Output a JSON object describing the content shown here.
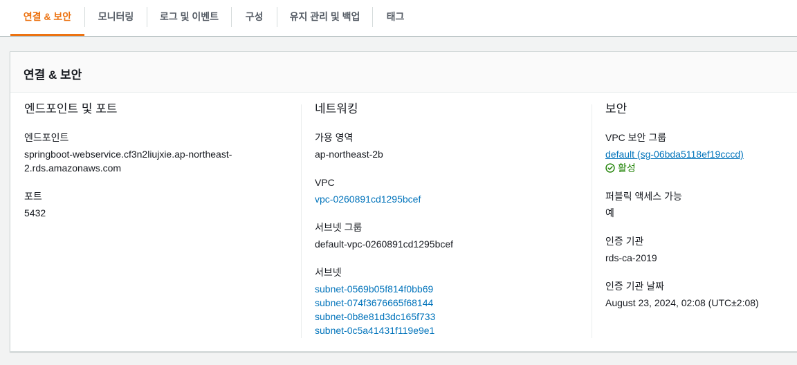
{
  "tabs": [
    {
      "label": "연결 & 보안",
      "active": true
    },
    {
      "label": "모니터링",
      "active": false
    },
    {
      "label": "로그 및 이벤트",
      "active": false
    },
    {
      "label": "구성",
      "active": false
    },
    {
      "label": "유지 관리 및 백업",
      "active": false
    },
    {
      "label": "태그",
      "active": false
    }
  ],
  "panel": {
    "title": "연결 & 보안",
    "endpoint_section": {
      "title": "엔드포인트 및 포트",
      "endpoint_label": "엔드포인트",
      "endpoint_value_line1": "springboot-webservice.cf3n2liujxie.ap-northeast-",
      "endpoint_value_line2": "2.rds.amazonaws.com",
      "port_label": "포트",
      "port_value": "5432"
    },
    "networking_section": {
      "title": "네트워킹",
      "az_label": "가용 영역",
      "az_value": "ap-northeast-2b",
      "vpc_label": "VPC",
      "vpc_value": "vpc-0260891cd1295bcef",
      "subnet_group_label": "서브넷 그룹",
      "subnet_group_value": "default-vpc-0260891cd1295bcef",
      "subnets_label": "서브넷",
      "subnets": [
        "subnet-0569b05f814f0bb69",
        "subnet-074f3676665f68144",
        "subnet-0b8e81d3dc165f733",
        "subnet-0c5a41431f119e9e1"
      ]
    },
    "security_section": {
      "title": "보안",
      "sg_label": "VPC 보안 그룹",
      "sg_value": "default (sg-06bda5118ef19cccd)",
      "sg_status": "활성",
      "public_label": "퍼블릭 액세스 가능",
      "public_value": "예",
      "ca_label": "인증 기관",
      "ca_value": "rds-ca-2019",
      "ca_date_label": "인증 기관 날짜",
      "ca_date_value": "August 23, 2024, 02:08 (UTC±2:08)"
    }
  },
  "colors": {
    "accent": "#ec7211",
    "link": "#0073bb",
    "success": "#1d8102"
  }
}
